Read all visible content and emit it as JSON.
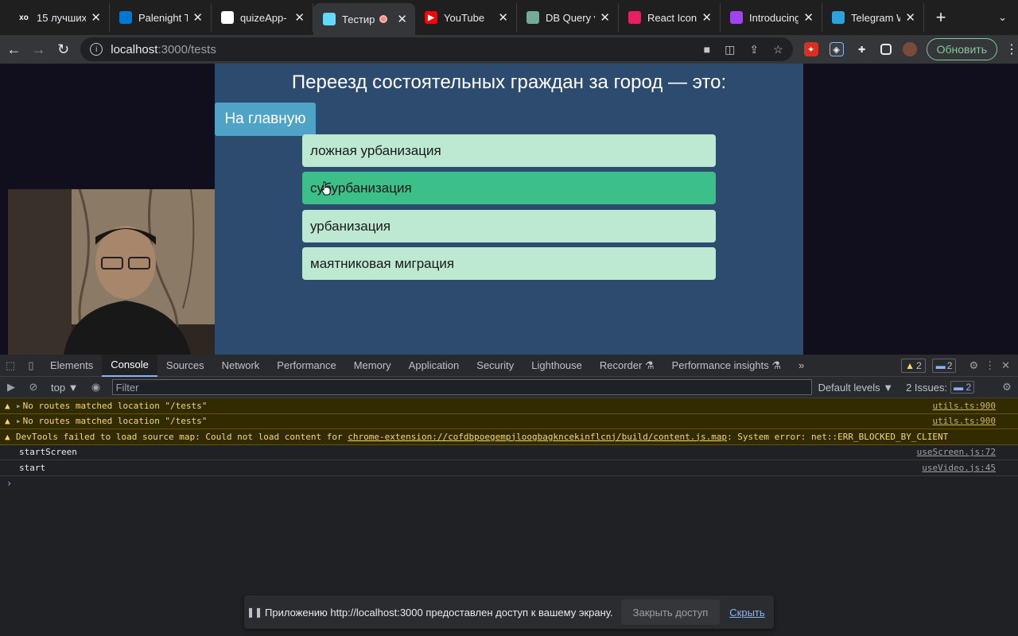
{
  "browser": {
    "tabs": [
      {
        "title": "15 лучших",
        "icon": "xo-icon",
        "color": "#1f1f1f",
        "text": "xo"
      },
      {
        "title": "Palenight T",
        "icon": "windows-icon",
        "color": "#0078d4",
        "text": ""
      },
      {
        "title": "quizeApp-",
        "icon": "github-icon",
        "color": "#ffffff",
        "text": ""
      },
      {
        "title": "Тестир",
        "icon": "react-icon",
        "color": "#61dafb",
        "text": "",
        "active": true
      },
      {
        "title": "YouTube",
        "icon": "youtube-icon",
        "color": "#ff0000",
        "text": "▶"
      },
      {
        "title": "DB Query v",
        "icon": "openai-icon",
        "color": "#74aa9c",
        "text": ""
      },
      {
        "title": "React Icon",
        "icon": "react-icons-icon",
        "color": "#e91e63",
        "text": ""
      },
      {
        "title": "Introducing",
        "icon": "introducing-icon",
        "color": "#a142f4",
        "text": ""
      },
      {
        "title": "Telegram W",
        "icon": "telegram-icon",
        "color": "#2aa3df",
        "text": ""
      }
    ],
    "url_host": "localhost",
    "url_path": ":3000/tests",
    "update_label": "Обновить"
  },
  "quiz": {
    "question": "Переезд состоятельных граждан за город — это:",
    "home_label": "На главную",
    "answers": [
      "ложная урбанизация",
      "субурбанизация",
      "урбанизация",
      "маятниковая миграция"
    ],
    "hovered_answer": 1
  },
  "devtools": {
    "tabs": [
      "Elements",
      "Console",
      "Sources",
      "Network",
      "Performance",
      "Memory",
      "Application",
      "Security",
      "Lighthouse",
      "Recorder ⚗",
      "Performance insights ⚗"
    ],
    "active_tab": "Console",
    "warnings_count": "2",
    "messages_count": "2",
    "context": "top ▼",
    "filter_placeholder": "Filter",
    "levels": "Default levels ▼",
    "issues_label": "2 Issues:",
    "issues_count": "2",
    "logs": [
      {
        "type": "warn",
        "expand": true,
        "text": "No routes matched location \"/tests\"",
        "source": "utils.ts:900"
      },
      {
        "type": "warn",
        "expand": true,
        "text": "No routes matched location \"/tests\"",
        "source": "utils.ts:900"
      },
      {
        "type": "warn",
        "expand": false,
        "text_pre": "DevTools failed to load source map: Could not load content for ",
        "text_link": "chrome-extension://cofdbpoegempjloogbagkncekinflcnj/build/content.js.map",
        "text_post": ": System error: net::ERR_BLOCKED_BY_CLIENT",
        "source": ""
      },
      {
        "type": "info",
        "expand": false,
        "text": "startScreen",
        "source": "useScreen.js:72"
      },
      {
        "type": "info",
        "expand": false,
        "text": "start",
        "source": "useVideo.js:45"
      }
    ],
    "prompt": "›"
  },
  "sharebar": {
    "message": "Приложению http://localhost:3000 предоставлен доступ к вашему экрану.",
    "stop_label": "Закрыть доступ",
    "hide_label": "Скрыть"
  }
}
